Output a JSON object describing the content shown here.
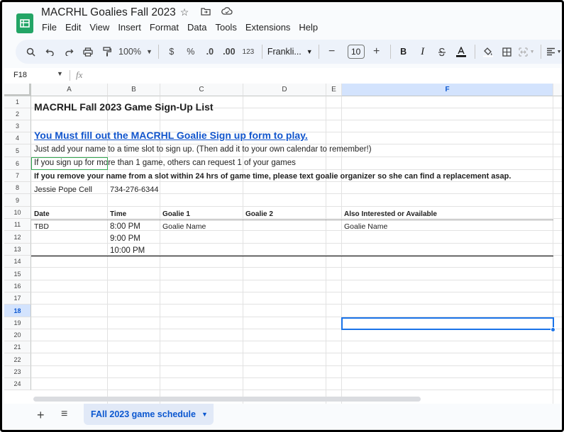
{
  "app": {
    "title": "MACRHL Goalies Fall 2023",
    "menu": [
      "File",
      "Edit",
      "View",
      "Insert",
      "Format",
      "Data",
      "Tools",
      "Extensions",
      "Help"
    ]
  },
  "toolbar": {
    "zoom": "100%",
    "currency": "$",
    "percent": "%",
    "decrease_decimal": ".0",
    "increase_decimal": ".00",
    "number_format": "123",
    "font": "Frankli...",
    "font_size": "10",
    "minus": "−",
    "plus": "+",
    "bold": "B",
    "italic": "I"
  },
  "formula_bar": {
    "name_box": "F18",
    "fx": "fx"
  },
  "grid": {
    "columns": [
      "A",
      "B",
      "C",
      "D",
      "E",
      "F"
    ],
    "rows": [
      "1",
      "2",
      "3",
      "4",
      "5",
      "6",
      "7",
      "8",
      "9",
      "10",
      "11",
      "12",
      "13",
      "14",
      "15",
      "16",
      "17",
      "18",
      "19",
      "20",
      "21",
      "22",
      "23",
      "24"
    ],
    "selected_cell": "F18"
  },
  "cells": {
    "r1": "MACRHL Fall 2023 Game Sign-Up List",
    "r3": "You Must fill out the MACRHL Goalie Sign up form to play.",
    "r4": "Just add your name to a time slot to sign up. (Then add it to your own calendar to remember!)",
    "r5": "If you sign up for more than 1 game, others can request 1 of your games",
    "r6": "If you remove your name from a slot within 24 hrs of game time, please text goalie organizer so she can find a replacement asap.",
    "r7_a": "Jessie Pope Cell",
    "r7_b": "734-276-6344",
    "r9_a": "Date",
    "r9_b": "Time",
    "r9_c": "Goalie 1",
    "r9_d": "Goalie 2",
    "r9_f": "Also Interested or Available",
    "r10_a": "TBD",
    "r10_b": "8:00 PM",
    "r10_c": "Goalie Name",
    "r10_f": "Goalie Name",
    "r11_b": "9:00 PM",
    "r12_b": "10:00 PM"
  },
  "sheets": {
    "active": "FAll 2023 game schedule"
  },
  "colors": {
    "accent": "#0b57d0",
    "link": "#1155cc",
    "sheets_green": "#23a566"
  }
}
